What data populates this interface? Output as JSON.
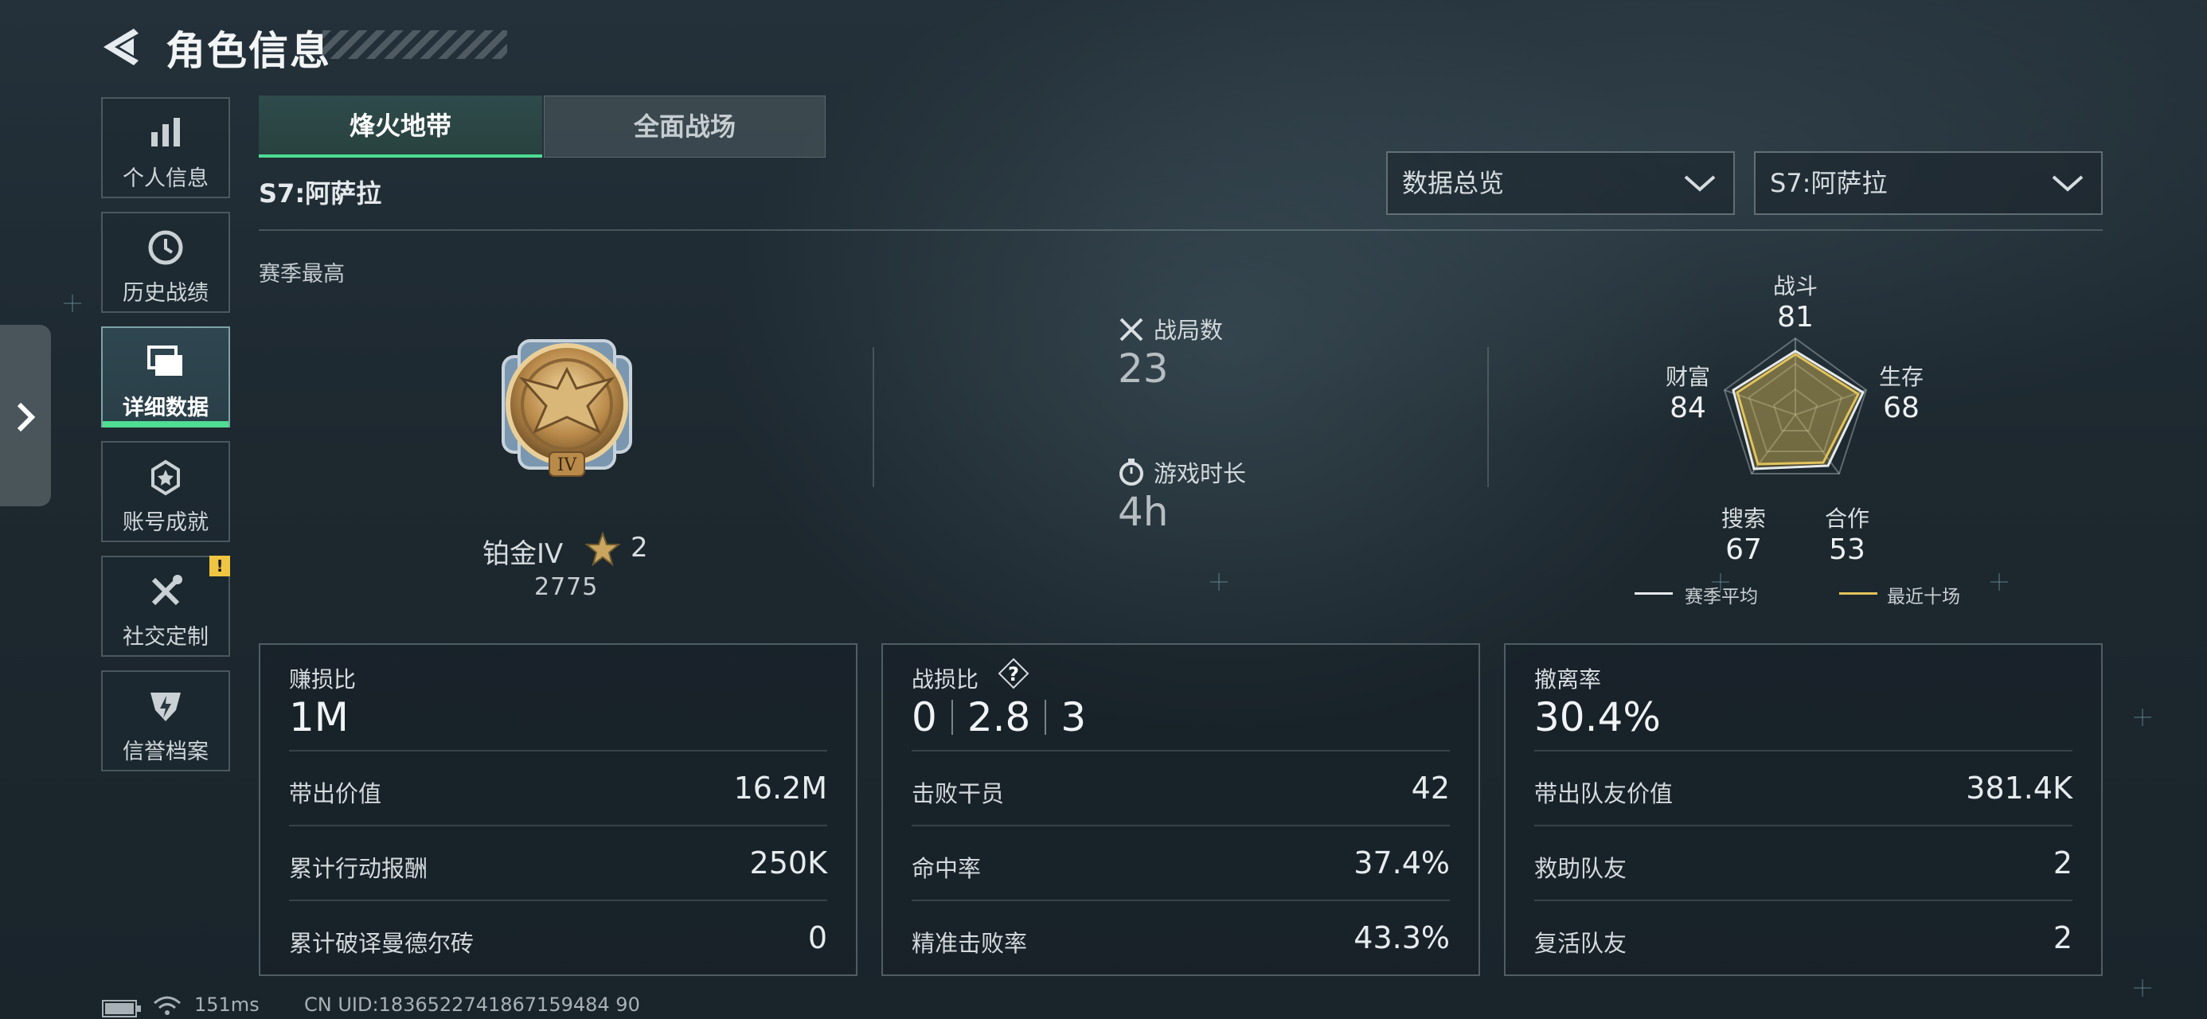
{
  "header": {
    "title": "角色信息"
  },
  "sidebar": {
    "items": [
      {
        "label": "个人信息",
        "icon": "bar-chart-icon"
      },
      {
        "label": "历史战绩",
        "icon": "history-icon"
      },
      {
        "label": "详细数据",
        "icon": "folders-icon",
        "active": true
      },
      {
        "label": "账号成就",
        "icon": "medal-icon"
      },
      {
        "label": "社交定制",
        "icon": "tools-icon",
        "badge": "!"
      },
      {
        "label": "信誉档案",
        "icon": "shield-bolt-icon"
      }
    ]
  },
  "tabs": [
    {
      "label": "烽火地带",
      "active": true
    },
    {
      "label": "全面战场",
      "active": false
    }
  ],
  "season": {
    "label": "S7:阿萨拉"
  },
  "filters": {
    "view": "数据总览",
    "season": "S7:阿萨拉"
  },
  "summary": {
    "section_label": "赛季最高",
    "rank": {
      "name": "铂金IV",
      "stars": "2",
      "points": "2775",
      "emblem_numeral": "IV"
    },
    "matches": {
      "label": "战局数",
      "value": "23"
    },
    "playtime": {
      "label": "游戏时长",
      "value": "4h"
    }
  },
  "radar": {
    "axes": [
      {
        "label": "战斗",
        "value": "81"
      },
      {
        "label": "生存",
        "value": "68"
      },
      {
        "label": "合作",
        "value": "53"
      },
      {
        "label": "搜索",
        "value": "67"
      },
      {
        "label": "财富",
        "value": "84"
      }
    ],
    "legend": [
      {
        "label": "赛季平均",
        "color": "#e6eaec"
      },
      {
        "label": "最近十场",
        "color": "#e2c35a"
      }
    ]
  },
  "cards": {
    "profit": {
      "title": "赚损比",
      "value": "1M",
      "rows": [
        {
          "label": "带出价值",
          "value": "16.2M"
        },
        {
          "label": "累计行动报酬",
          "value": "250K"
        },
        {
          "label": "累计破译曼德尔砖",
          "value": "0"
        }
      ]
    },
    "combat": {
      "title": "战损比",
      "kd": [
        "0",
        "2.8",
        "3"
      ],
      "rows": [
        {
          "label": "击败干员",
          "value": "42"
        },
        {
          "label": "命中率",
          "value": "37.4%"
        },
        {
          "label": "精准击败率",
          "value": "43.3%"
        }
      ]
    },
    "extract": {
      "title": "撤离率",
      "value": "30.4%",
      "rows": [
        {
          "label": "带出队友价值",
          "value": "381.4K"
        },
        {
          "label": "救助队友",
          "value": "2"
        },
        {
          "label": "复活队友",
          "value": "2"
        }
      ]
    }
  },
  "footer": {
    "ping": "151ms",
    "uid": "CN UID:1836522741867159484 90"
  },
  "colors": {
    "accent": "#4fdc93",
    "gold": "#e2c35a",
    "badge": "#f0c542"
  }
}
